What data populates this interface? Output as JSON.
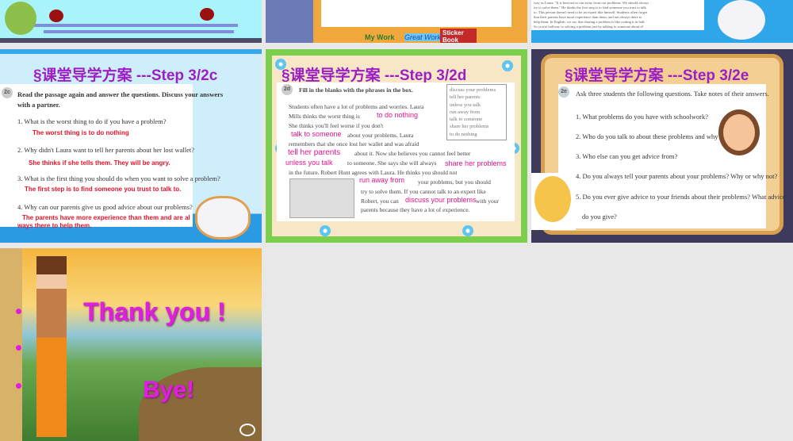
{
  "slides": [
    {
      "id": "slide-partial-1"
    },
    {
      "id": "slide-partial-2",
      "labels": [
        "My Work",
        "Great Work",
        "Sticker Book"
      ]
    },
    {
      "id": "slide-partial-3",
      "lines": [
        "way as Laura. \"It is best not to run away from our problems. We should always",
        "try to solve them.\" He thinks the first step is to find someone you trust to talk",
        "to. This person doesn't need to be an expert like himself. Students often forget",
        "that their parents have more experience than them, and are always there to",
        "help them. In English, we say that sharing a problem is like cutting it in half.",
        "So you're halfway to solving a problem just by talking to someone about it!"
      ]
    },
    {
      "title": "§课堂导学方案 ---Step 3/2c",
      "badge": "2c",
      "instruction": "Read the passage again and answer the questions. Discuss your answers",
      "instruction2": "with a partner.",
      "qa": [
        {
          "q": "1. What is the worst thing to do if you have a problem?",
          "a": "The worst thing is to do nothing"
        },
        {
          "q": "2. Why didn't Laura want to tell her parents about her lost wallet?",
          "a": "She thinks if she tells them. They will be angry."
        },
        {
          "q": "3. What is the first thing you should do when you want to solve a problem?",
          "a": "The first step is to find someone you trust to talk to."
        },
        {
          "q": "4. Why can our parents give us good advice about our problems?",
          "a": "The parents have more experience than them and are al",
          "a2": "ways there to help them."
        }
      ]
    },
    {
      "title": "§课堂导学方案 ---Step 3/2d",
      "badge": "2d",
      "instruction": "Fill in the blanks with the phrases in the box.",
      "box": [
        "discuss your problems",
        "tell her parents",
        "unless you talk",
        "run away from",
        "talk to someone",
        "share her problems",
        "to do nothing"
      ],
      "passage": [
        "Students often have a lot of problems and worries. Laura",
        "Mills thinks the worst thing is",
        "She thinks you'll feel worse if you don't",
        "about your problems. Laura",
        "remembers that she once lost her wallet and was afraid",
        "about it. Now she believes you cannot feel better",
        "to someone. She says she will always",
        "in the future. Robert Hunt agrees with Laura. He thinks you should not",
        "your problems, but you should",
        "try to solve them. If you cannot talk to an expert like",
        "Robert, you can",
        "with your",
        "parents because they have a lot of experience."
      ],
      "answers": [
        "to do nothing",
        "talk to someone",
        "tell her parents",
        "unless you talk",
        "share her problems",
        "run away from",
        "discuss your problems"
      ]
    },
    {
      "title": "§课堂导学方案 ---Step 3/2e",
      "badge": "2e",
      "instruction": "Ask three students the following questions. Take notes of their answers.",
      "questions": [
        "1. What problems do you have with schoolwork?",
        "2. Who do you talk to about these problems and why?",
        "3. Who else can you get advice from?",
        "4. Do you always tell your parents about your problems? Why or why not?",
        "5. Do you ever give advice to your friends about their problems? What advice",
        "do you give?"
      ]
    },
    {
      "thanks": "Thank you !",
      "bye": "Bye!"
    }
  ],
  "colors": {
    "title": "#9b1fc4",
    "answer_red": "#e4142a",
    "answer_pink": "#e2148c",
    "background": "#e8e8e8"
  }
}
